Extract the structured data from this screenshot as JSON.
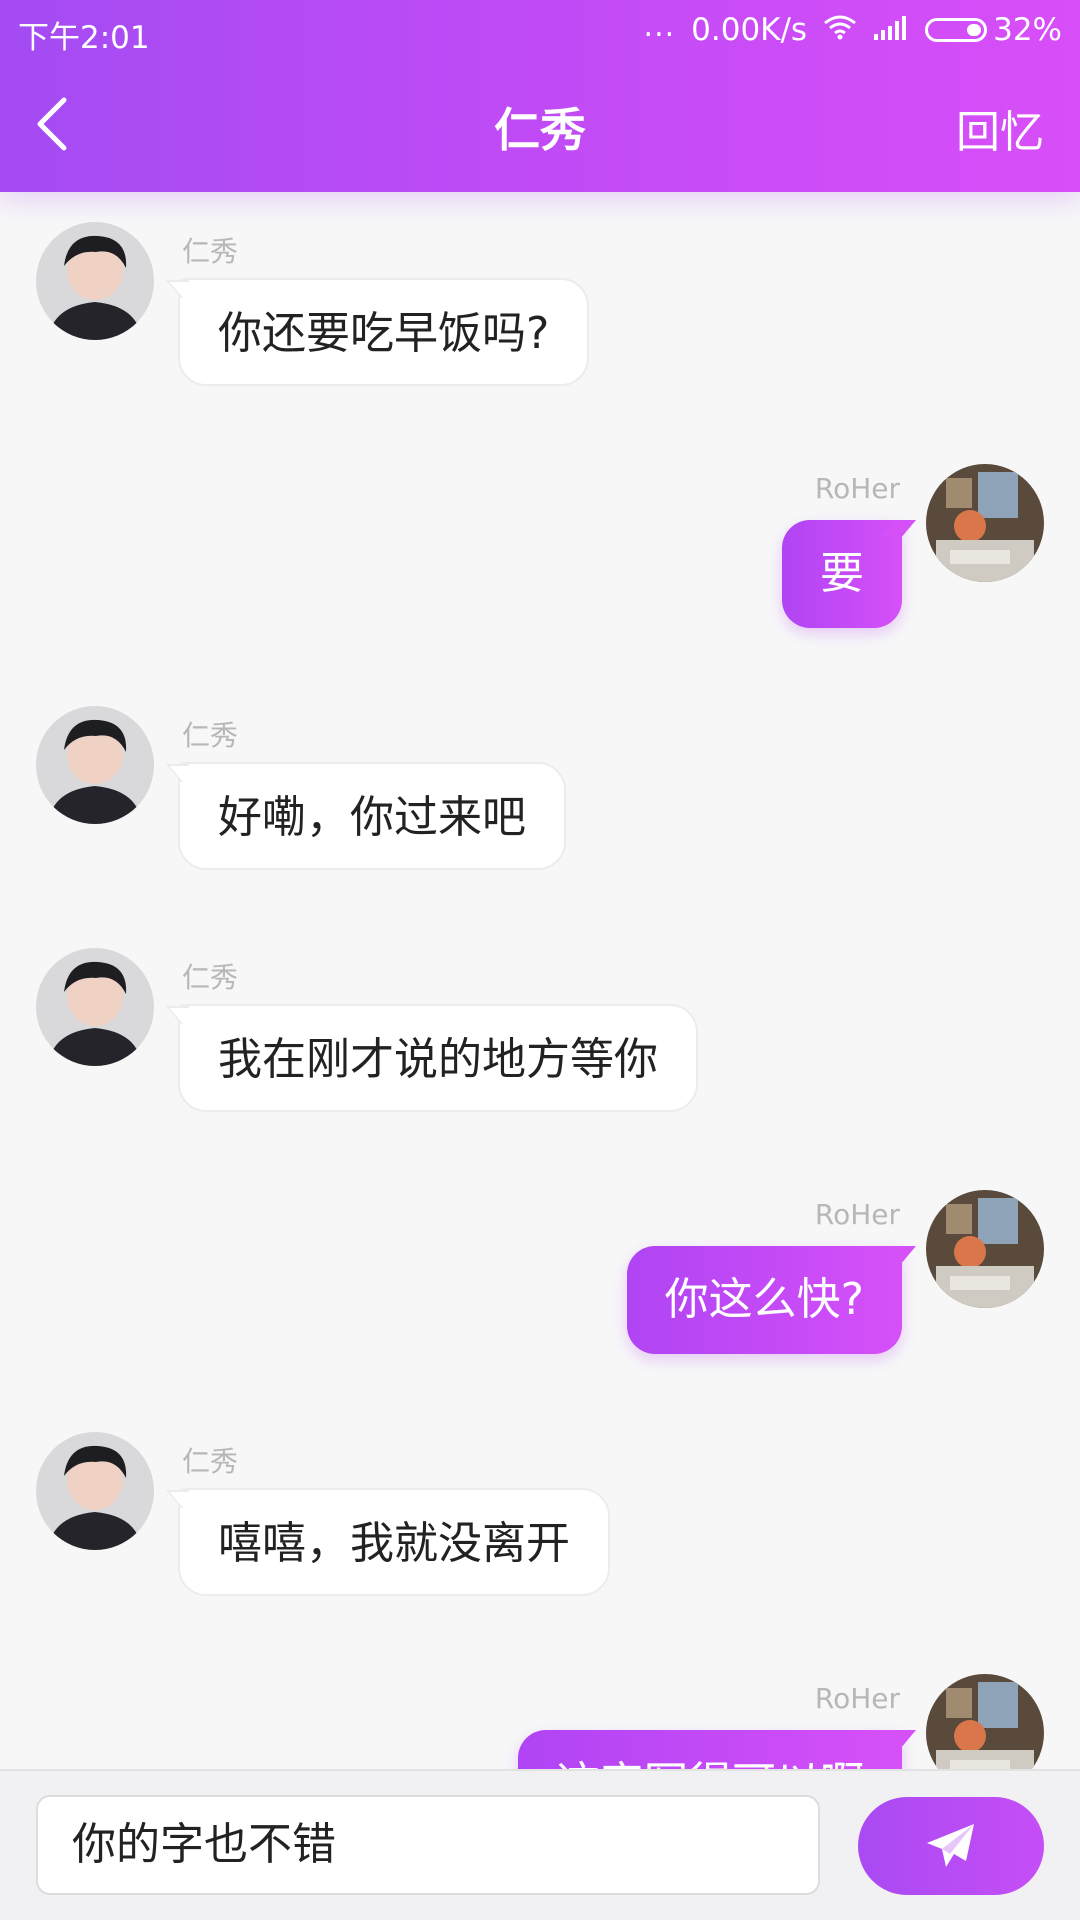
{
  "status_bar": {
    "time": "下午2:01",
    "dots": "...",
    "speed": "0.00K/s",
    "battery": "32%"
  },
  "header": {
    "title": "仁秀",
    "memory_label": "回忆"
  },
  "messages": [
    {
      "side": "left",
      "sender": "仁秀",
      "text": "你还要吃早饭吗?"
    },
    {
      "side": "right",
      "sender": "RoHer",
      "text": "要"
    },
    {
      "side": "left",
      "sender": "仁秀",
      "text": "好嘞，你过来吧"
    },
    {
      "side": "left",
      "sender": "仁秀",
      "text": "我在刚才说的地方等你"
    },
    {
      "side": "right",
      "sender": "RoHer",
      "text": "你这么快?"
    },
    {
      "side": "left",
      "sender": "仁秀",
      "text": "嘻嘻，我就没离开"
    },
    {
      "side": "right",
      "sender": "RoHer",
      "text": "这字写得可以啊"
    }
  ],
  "composer": {
    "input_value": "你的字也不错",
    "send_icon": "paper-plane-icon"
  },
  "colors": {
    "accent_start": "#a44bf3",
    "accent_end": "#d84ef8",
    "background": "#f7f7f8"
  }
}
